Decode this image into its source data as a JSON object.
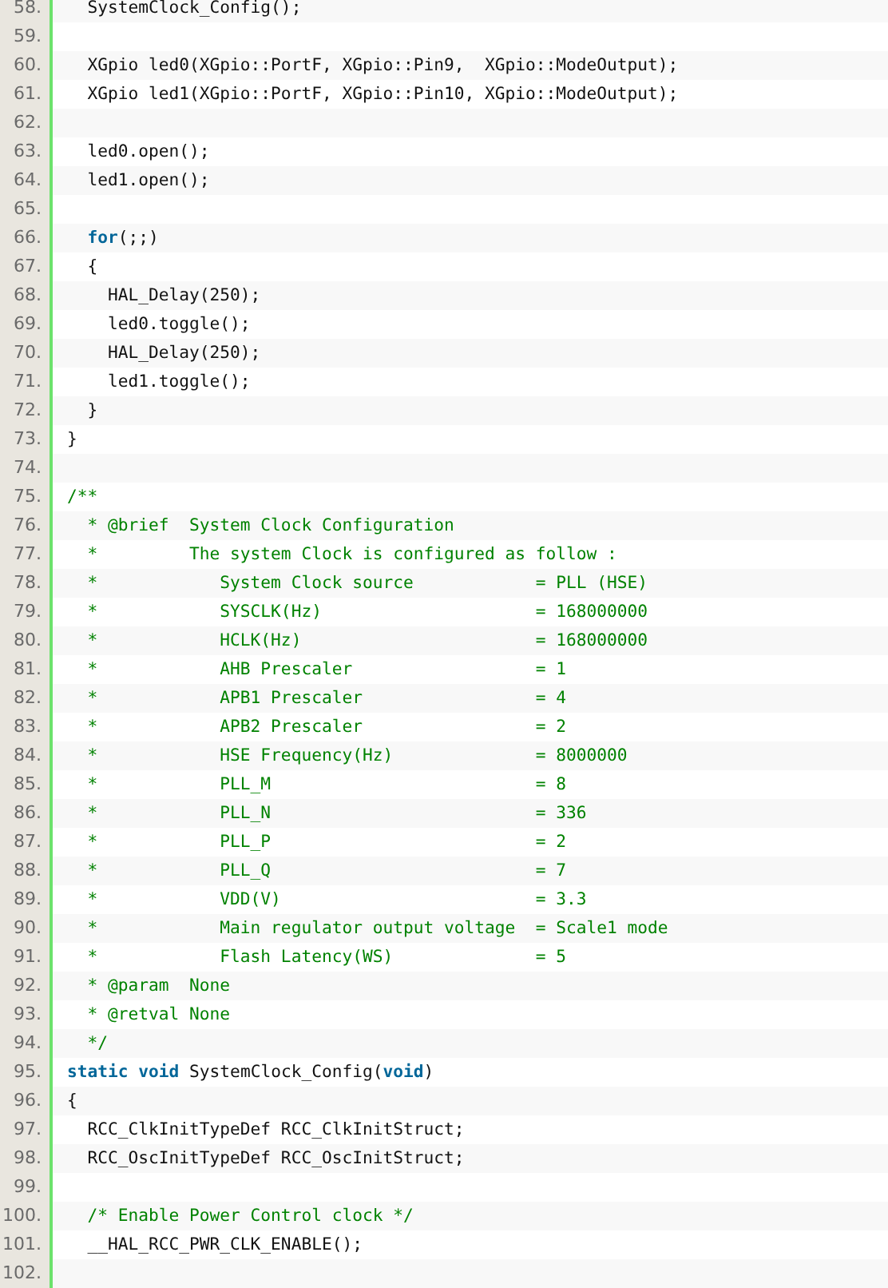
{
  "code_lines": [
    {
      "number": "58.",
      "segments": [
        {
          "kind": "plain",
          "text": "  SystemClock_Config();"
        }
      ]
    },
    {
      "number": "59."
    },
    {
      "number": "60.",
      "segments": [
        {
          "kind": "plain",
          "text": "  XGpio led0(XGpio::PortF, XGpio::Pin9,  XGpio::ModeOutput);"
        }
      ]
    },
    {
      "number": "61.",
      "segments": [
        {
          "kind": "plain",
          "text": "  XGpio led1(XGpio::PortF, XGpio::Pin10, XGpio::ModeOutput);"
        }
      ]
    },
    {
      "number": "62."
    },
    {
      "number": "63.",
      "segments": [
        {
          "kind": "plain",
          "text": "  led0.open();"
        }
      ]
    },
    {
      "number": "64.",
      "segments": [
        {
          "kind": "plain",
          "text": "  led1.open();"
        }
      ]
    },
    {
      "number": "65."
    },
    {
      "number": "66.",
      "segments": [
        {
          "kind": "keyword",
          "text": "  for"
        },
        {
          "kind": "plain",
          "text": "(;;)"
        }
      ]
    },
    {
      "number": "67.",
      "segments": [
        {
          "kind": "plain",
          "text": "  {"
        }
      ]
    },
    {
      "number": "68.",
      "segments": [
        {
          "kind": "plain",
          "text": "    HAL_Delay(250);"
        }
      ]
    },
    {
      "number": "69.",
      "segments": [
        {
          "kind": "plain",
          "text": "    led0.toggle();"
        }
      ]
    },
    {
      "number": "70.",
      "segments": [
        {
          "kind": "plain",
          "text": "    HAL_Delay(250);"
        }
      ]
    },
    {
      "number": "71.",
      "segments": [
        {
          "kind": "plain",
          "text": "    led1.toggle();"
        }
      ]
    },
    {
      "number": "72.",
      "segments": [
        {
          "kind": "plain",
          "text": "  }"
        }
      ]
    },
    {
      "number": "73.",
      "segments": [
        {
          "kind": "plain",
          "text": "}"
        }
      ]
    },
    {
      "number": "74."
    },
    {
      "number": "75.",
      "segments": [
        {
          "kind": "comment",
          "text": "/**"
        }
      ]
    },
    {
      "number": "76.",
      "segments": [
        {
          "kind": "comment",
          "text": "  * @brief  System Clock Configuration"
        }
      ]
    },
    {
      "number": "77.",
      "segments": [
        {
          "kind": "comment",
          "text": "  *         The system Clock is configured as follow :"
        }
      ]
    },
    {
      "number": "78.",
      "segments": [
        {
          "kind": "comment",
          "text": "  *            System Clock source            = PLL (HSE)"
        }
      ]
    },
    {
      "number": "79.",
      "segments": [
        {
          "kind": "comment",
          "text": "  *            SYSCLK(Hz)                     = 168000000"
        }
      ]
    },
    {
      "number": "80.",
      "segments": [
        {
          "kind": "comment",
          "text": "  *            HCLK(Hz)                       = 168000000"
        }
      ]
    },
    {
      "number": "81.",
      "segments": [
        {
          "kind": "comment",
          "text": "  *            AHB Prescaler                  = 1"
        }
      ]
    },
    {
      "number": "82.",
      "segments": [
        {
          "kind": "comment",
          "text": "  *            APB1 Prescaler                 = 4"
        }
      ]
    },
    {
      "number": "83.",
      "segments": [
        {
          "kind": "comment",
          "text": "  *            APB2 Prescaler                 = 2"
        }
      ]
    },
    {
      "number": "84.",
      "segments": [
        {
          "kind": "comment",
          "text": "  *            HSE Frequency(Hz)              = 8000000"
        }
      ]
    },
    {
      "number": "85.",
      "segments": [
        {
          "kind": "comment",
          "text": "  *            PLL_M                          = 8"
        }
      ]
    },
    {
      "number": "86.",
      "segments": [
        {
          "kind": "comment",
          "text": "  *            PLL_N                          = 336"
        }
      ]
    },
    {
      "number": "87.",
      "segments": [
        {
          "kind": "comment",
          "text": "  *            PLL_P                          = 2"
        }
      ]
    },
    {
      "number": "88.",
      "segments": [
        {
          "kind": "comment",
          "text": "  *            PLL_Q                          = 7"
        }
      ]
    },
    {
      "number": "89.",
      "segments": [
        {
          "kind": "comment",
          "text": "  *            VDD(V)                         = 3.3"
        }
      ]
    },
    {
      "number": "90.",
      "segments": [
        {
          "kind": "comment",
          "text": "  *            Main regulator output voltage  = Scale1 mode"
        }
      ]
    },
    {
      "number": "91.",
      "segments": [
        {
          "kind": "comment",
          "text": "  *            Flash Latency(WS)              = 5"
        }
      ]
    },
    {
      "number": "92.",
      "segments": [
        {
          "kind": "comment",
          "text": "  * @param  None"
        }
      ]
    },
    {
      "number": "93.",
      "segments": [
        {
          "kind": "comment",
          "text": "  * @retval None"
        }
      ]
    },
    {
      "number": "94.",
      "segments": [
        {
          "kind": "comment",
          "text": "  */"
        }
      ]
    },
    {
      "number": "95.",
      "segments": [
        {
          "kind": "keyword",
          "text": "static void"
        },
        {
          "kind": "plain",
          "text": " SystemClock_Config("
        },
        {
          "kind": "keyword",
          "text": "void"
        },
        {
          "kind": "plain",
          "text": ")"
        }
      ]
    },
    {
      "number": "96.",
      "segments": [
        {
          "kind": "plain",
          "text": "{"
        }
      ]
    },
    {
      "number": "97.",
      "segments": [
        {
          "kind": "plain",
          "text": "  RCC_ClkInitTypeDef RCC_ClkInitStruct;"
        }
      ]
    },
    {
      "number": "98.",
      "segments": [
        {
          "kind": "plain",
          "text": "  RCC_OscInitTypeDef RCC_OscInitStruct;"
        }
      ]
    },
    {
      "number": "99."
    },
    {
      "number": "100.",
      "segments": [
        {
          "kind": "comment",
          "text": "  /* Enable Power Control clock */"
        }
      ]
    },
    {
      "number": "101.",
      "segments": [
        {
          "kind": "plain",
          "text": "  __HAL_RCC_PWR_CLK_ENABLE();"
        }
      ]
    },
    {
      "number": "102."
    }
  ]
}
